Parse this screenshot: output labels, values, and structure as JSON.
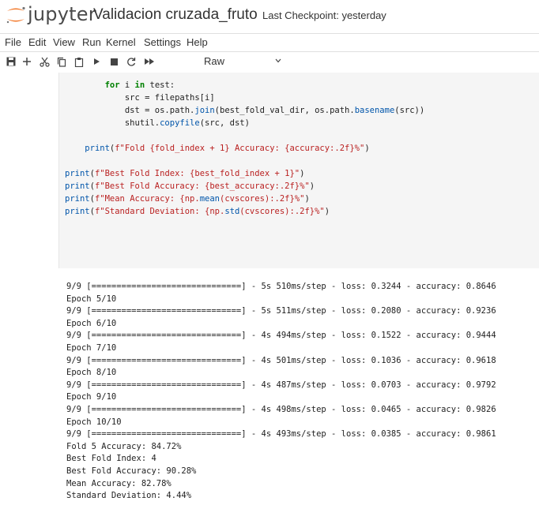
{
  "header": {
    "brand": "jupyter",
    "notebook_title": "Validacion cruzada_fruto",
    "checkpoint": "Last Checkpoint: yesterday"
  },
  "menu": [
    "File",
    "Edit",
    "View",
    "Run",
    "Kernel",
    "Settings",
    "Help"
  ],
  "toolbar": {
    "icons": [
      "save-icon",
      "add-cell-icon",
      "cut-icon",
      "copy-icon",
      "paste-icon",
      "run-icon",
      "stop-icon",
      "restart-icon",
      "fast-forward-icon"
    ],
    "cell_type": "Raw"
  },
  "code_lines": [
    "        for i in test:",
    "            src = filepaths[i]",
    "            dst = os.path.join(best_fold_val_dir, os.path.basename(src))",
    "            shutil.copyfile(src, dst)",
    "",
    "    print(f\"Fold {fold_index + 1} Accuracy: {accuracy:.2f}%\")",
    "",
    "print(f\"Best Fold Index: {best_fold_index + 1}\")",
    "print(f\"Best Fold Accuracy: {best_accuracy:.2f}%\")",
    "print(f\"Mean Accuracy: {np.mean(cvscores):.2f}%\")",
    "print(f\"Standard Deviation: {np.std(cvscores):.2f}%\")"
  ],
  "output_lines": [
    "9/9 [==============================] - 5s 510ms/step - loss: 0.3244 - accuracy: 0.8646",
    "Epoch 5/10",
    "9/9 [==============================] - 5s 511ms/step - loss: 0.2080 - accuracy: 0.9236",
    "Epoch 6/10",
    "9/9 [==============================] - 4s 494ms/step - loss: 0.1522 - accuracy: 0.9444",
    "Epoch 7/10",
    "9/9 [==============================] - 4s 501ms/step - loss: 0.1036 - accuracy: 0.9618",
    "Epoch 8/10",
    "9/9 [==============================] - 4s 487ms/step - loss: 0.0703 - accuracy: 0.9792",
    "Epoch 9/10",
    "9/9 [==============================] - 4s 498ms/step - loss: 0.0465 - accuracy: 0.9826",
    "Epoch 10/10",
    "9/9 [==============================] - 4s 493ms/step - loss: 0.0385 - accuracy: 0.9861",
    "Fold 5 Accuracy: 84.72%",
    "Best Fold Index: 4",
    "Best Fold Accuracy: 90.28%",
    "Mean Accuracy: 82.78%",
    "Standard Deviation: 4.44%"
  ],
  "colors": {
    "logo_orange": "#f37626",
    "cell_bg": "#f5f5f5",
    "keyword_green": "#008000",
    "string_red": "#ba2121"
  }
}
